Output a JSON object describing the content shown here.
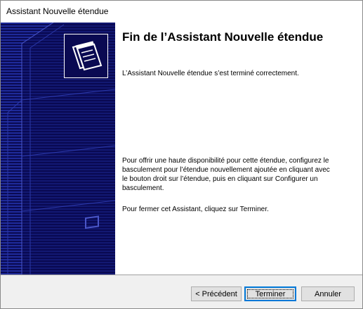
{
  "window": {
    "title": "Assistant Nouvelle étendue"
  },
  "content": {
    "heading": "Fin de l’Assistant Nouvelle étendue",
    "intro": "L’Assistant Nouvelle étendue s’est terminé correctement.",
    "paragraph_failover": "Pour offrir une haute disponibilité pour cette étendue, configurez le basculement pour l’étendue nouvellement ajoutée en cliquant avec le bouton droit sur l’étendue, puis en cliquant sur Configurer un basculement.",
    "paragraph_close": "Pour fermer cet Assistant, cliquez sur Terminer."
  },
  "buttons": {
    "back": "< Précédent",
    "finish": "Terminer",
    "cancel": "Annuler"
  },
  "colors": {
    "side_panel": "#0a0a52",
    "side_stripes": "#1e2a9a",
    "focus_border": "#0078d7"
  },
  "icons": {
    "wizard_image": "server-tower-graphic",
    "folders": "folders-icon"
  }
}
